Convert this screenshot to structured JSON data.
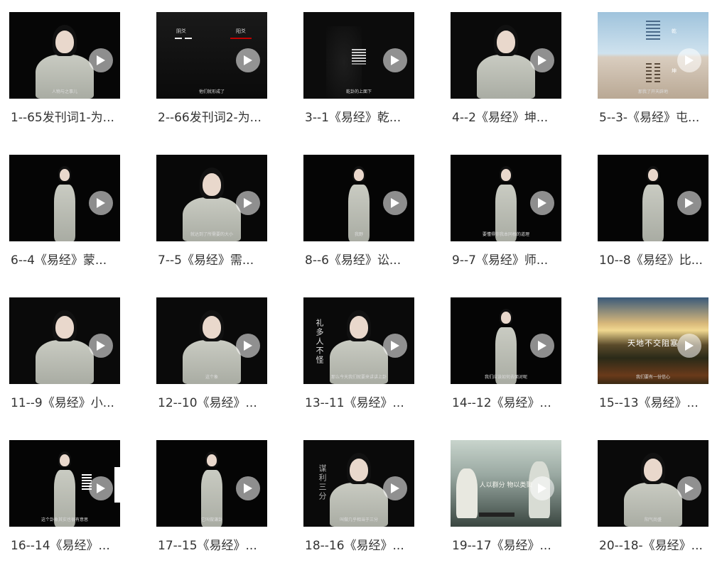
{
  "videos": [
    {
      "title": "1--65发刊词1-为...",
      "subtitle": "人物与之事儿",
      "scene": "presenter-close",
      "bg": "#060606",
      "overlay": ""
    },
    {
      "title": "2--66发刊词2-为...",
      "subtitle": "他们就形成了",
      "scene": "yao-lines",
      "bg": "#151515",
      "overlay": "阳爻 阴爻"
    },
    {
      "title": "3--1《易经》乾...",
      "subtitle": "乾卦的上面下",
      "scene": "hexagram-dark",
      "bg": "#0c0c0c",
      "overlay": ""
    },
    {
      "title": "4--2《易经》坤...",
      "subtitle": "",
      "scene": "presenter-close",
      "bg": "#0a0a0a",
      "overlay": ""
    },
    {
      "title": "5--3-《易经》屯...",
      "subtitle": "那我了开天辟地",
      "scene": "sky-split",
      "bg": "#8fb4cf",
      "overlay": "乾 坤"
    },
    {
      "title": "6--4《易经》蒙...",
      "subtitle": "",
      "scene": "presenter-full",
      "bg": "#050505",
      "overlay": ""
    },
    {
      "title": "7--5《易经》需...",
      "subtitle": "就达到了所需要的大小",
      "scene": "presenter-close",
      "bg": "#080808",
      "overlay": ""
    },
    {
      "title": "8--6《易经》讼...",
      "subtitle": "我野",
      "scene": "presenter-full",
      "bg": "#050505",
      "overlay": ""
    },
    {
      "title": "9--7《易经》师...",
      "subtitle": "要懂得你我本同根的道理",
      "scene": "presenter-full",
      "bg": "#050505",
      "overlay": ""
    },
    {
      "title": "10--8《易经》比...",
      "subtitle": "",
      "scene": "presenter-full",
      "bg": "#050505",
      "overlay": ""
    },
    {
      "title": "11--9《易经》小...",
      "subtitle": "",
      "scene": "presenter-close",
      "bg": "#0a0a0a",
      "overlay": ""
    },
    {
      "title": "12--10《易经》...",
      "subtitle": "这个象",
      "scene": "presenter-close",
      "bg": "#0a0a0a",
      "overlay": ""
    },
    {
      "title": "13--11《易经》...",
      "subtitle": "那么今天我们就要来讲讲上卦",
      "scene": "presenter-vert",
      "bg": "#0a0a0a",
      "overlay": "礼多人不怪"
    },
    {
      "title": "14--12《易经》...",
      "subtitle": "我们应该如何去面对呢",
      "scene": "presenter-full",
      "bg": "#050505",
      "overlay": ""
    },
    {
      "title": "15--13《易经》...",
      "subtitle": "我们要有一份信心",
      "scene": "sunset",
      "bg": "#4a4a3a",
      "overlay": "天地不交阻塞"
    },
    {
      "title": "16--14《易经》...",
      "subtitle": "这个卦象其实也很有意思",
      "scene": "presenter-hex",
      "bg": "#050505",
      "overlay": ""
    },
    {
      "title": "17--15《易经》...",
      "subtitle": "它叫做谦卦",
      "scene": "presenter-full",
      "bg": "#050505",
      "overlay": ""
    },
    {
      "title": "18--16《易经》...",
      "subtitle": "叫做几乎相当于三分",
      "scene": "presenter-vert2",
      "bg": "#0a0a0a",
      "overlay": "谋利三分"
    },
    {
      "title": "19--17《易经》...",
      "subtitle": "",
      "scene": "painting",
      "bg": "#8a9a94",
      "overlay": "人以群分 物以类聚"
    },
    {
      "title": "20--18-《易经》...",
      "subtitle": "阳气尚盛",
      "scene": "presenter-close",
      "bg": "#0a0a0a",
      "overlay": ""
    }
  ]
}
